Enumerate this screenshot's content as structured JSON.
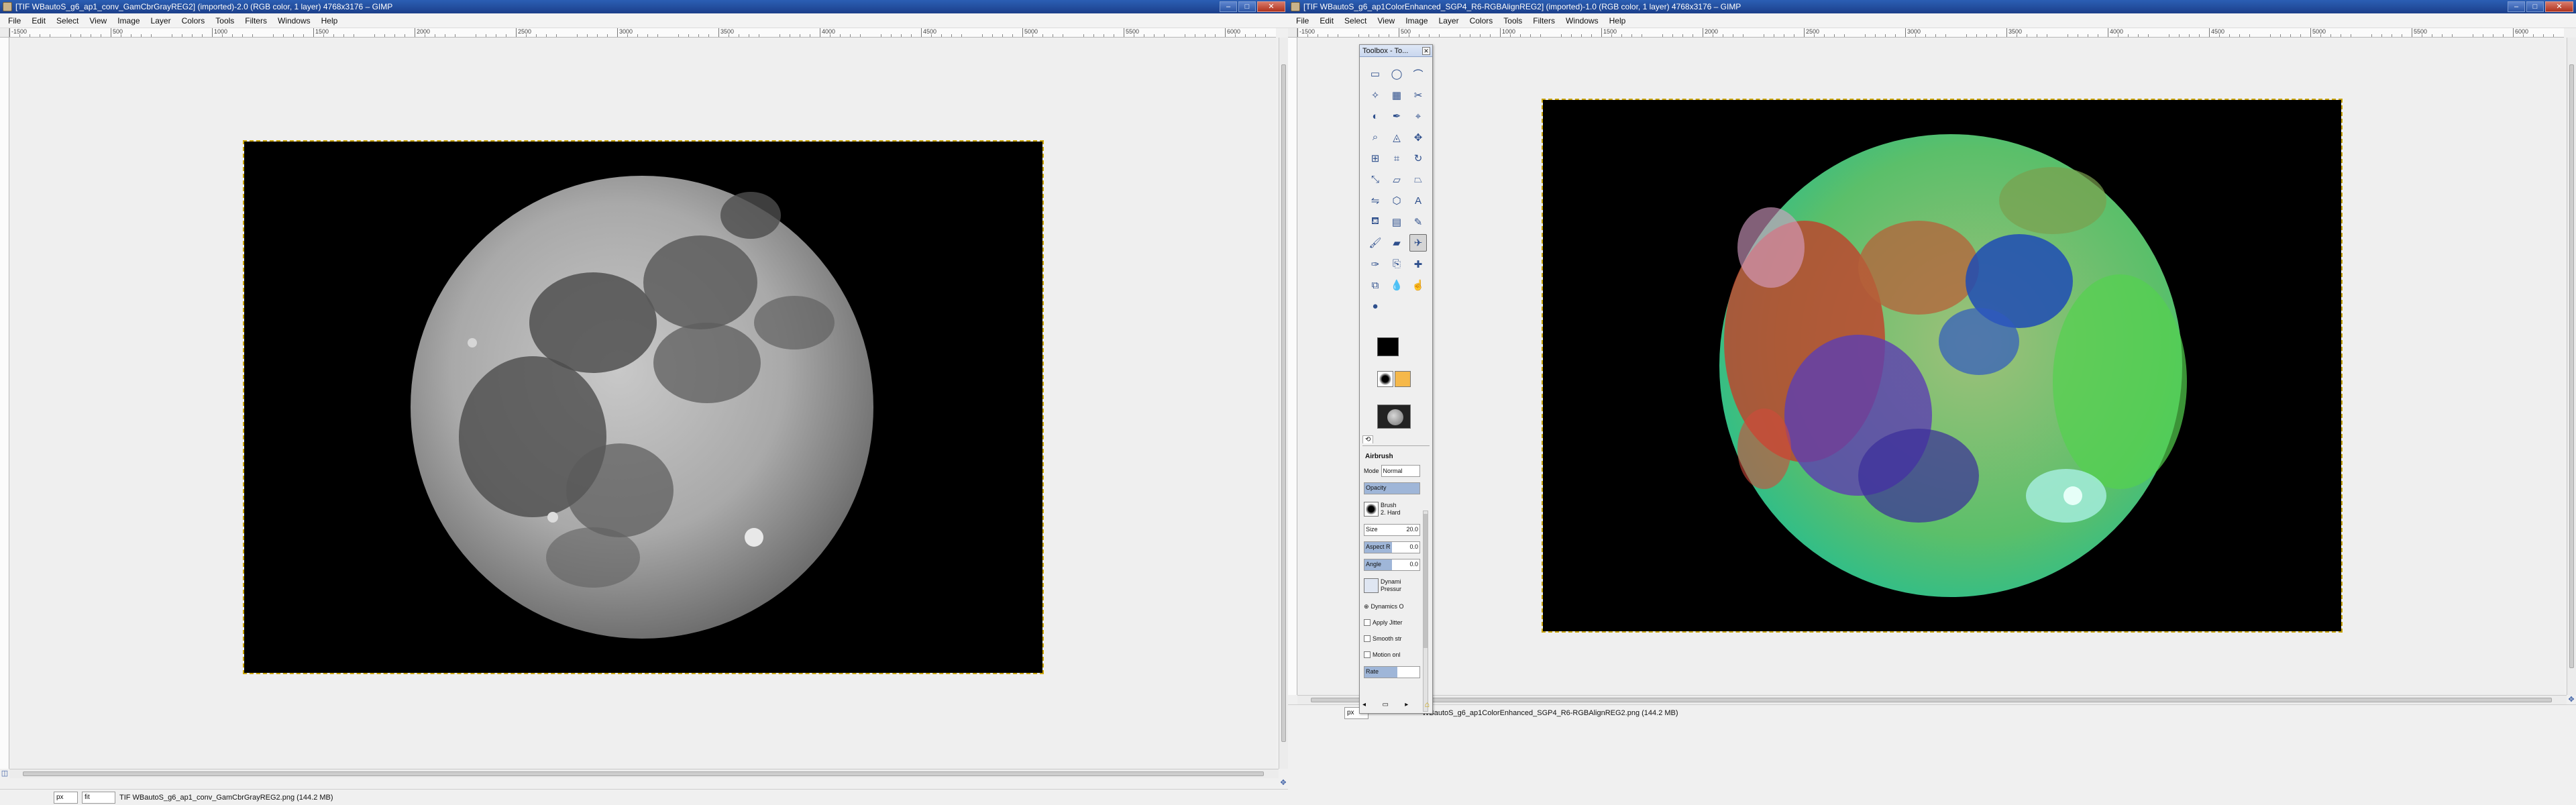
{
  "left_window": {
    "title": "[TIF WBautoS_g6_ap1_conv_GamCbrGrayREG2] (imported)-2.0 (RGB color, 1 layer) 4768x3176 – GIMP",
    "menu": [
      "File",
      "Edit",
      "Select",
      "View",
      "Image",
      "Layer",
      "Colors",
      "Tools",
      "Filters",
      "Windows",
      "Help"
    ],
    "ruler_ticks": [
      "-1500",
      "",
      "500",
      "",
      "1000",
      "",
      "1500",
      "",
      "2000",
      "",
      "2500",
      "",
      "3000",
      "",
      "3500",
      "",
      "4000",
      "",
      "4500",
      "",
      "5000",
      "",
      "5500",
      "",
      "6000"
    ],
    "status": {
      "unit": "px",
      "zoom": "fit",
      "text": "TIF WBautoS_g6_ap1_conv_GamCbrGrayREG2.png (144.2 MB)"
    }
  },
  "right_window": {
    "title": "[TIF WBautoS_g6_ap1ColorEnhanced_SGP4_R6-RGBAlignREG2] (imported)-1.0 (RGB color, 1 layer) 4768x3176 – GIMP",
    "menu": [
      "File",
      "Edit",
      "Select",
      "View",
      "Image",
      "Layer",
      "Colors",
      "Tools",
      "Filters",
      "Windows",
      "Help"
    ],
    "ruler_ticks": [
      "-1500",
      "",
      "500",
      "",
      "1000",
      "",
      "1500",
      "",
      "2000",
      "",
      "2500",
      "",
      "3000",
      "",
      "3500",
      "",
      "4000",
      "",
      "4500",
      "",
      "5000",
      "",
      "5500",
      "",
      "6000"
    ],
    "status": {
      "unit": "px",
      "text": "WBautoS_g6_ap1ColorEnhanced_SGP4_R6-RGBAlignREG2.png (144.2 MB)"
    }
  },
  "toolbox": {
    "title": "Toolbox - To...",
    "tools": [
      [
        "rect-select-icon",
        "ellipse-select-icon",
        "free-select-icon"
      ],
      [
        "fuzzy-select-icon",
        "select-by-color-icon",
        "scissors-icon"
      ],
      [
        "foreground-select-icon",
        "paths-icon",
        "color-picker-icon"
      ],
      [
        "zoom-icon",
        "measure-icon",
        "move-icon"
      ],
      [
        "align-icon",
        "crop-icon",
        "rotate-icon"
      ],
      [
        "scale-icon",
        "shear-icon",
        "perspective-icon"
      ],
      [
        "flip-icon",
        "cage-icon",
        "text-icon"
      ],
      [
        "bucket-fill-icon",
        "blend-icon",
        "pencil-icon"
      ],
      [
        "paintbrush-icon",
        "eraser-icon",
        "airbrush-icon"
      ],
      [
        "ink-icon",
        "clone-icon",
        "heal-icon"
      ],
      [
        "perspective-clone-icon",
        "blur-icon",
        "smudge-icon"
      ],
      [
        "dodge-burn-icon",
        "",
        ""
      ]
    ],
    "options": {
      "tool_name": "Airbrush",
      "mode_label": "Mode",
      "mode_value": "Normal",
      "opacity_label": "Opacity",
      "brush_label": "Brush",
      "brush_value": "2. Hard",
      "size_label": "Size",
      "size_value": "20.0",
      "aspect_label": "Aspect R",
      "aspect_value": "0.0",
      "angle_label": "Angle",
      "angle_value": "0.0",
      "dynamics_label": "Dynami",
      "dynamics_value": "Pressur",
      "checks": [
        "Dynamics O",
        "Apply Jitter",
        "Smooth str",
        "Motion onl"
      ],
      "rate_label": "Rate"
    }
  },
  "colors": {
    "titlebar": "#1f4a9a",
    "image_border": "#c9a400",
    "foreground": "#000000",
    "background": "#ffffff"
  }
}
